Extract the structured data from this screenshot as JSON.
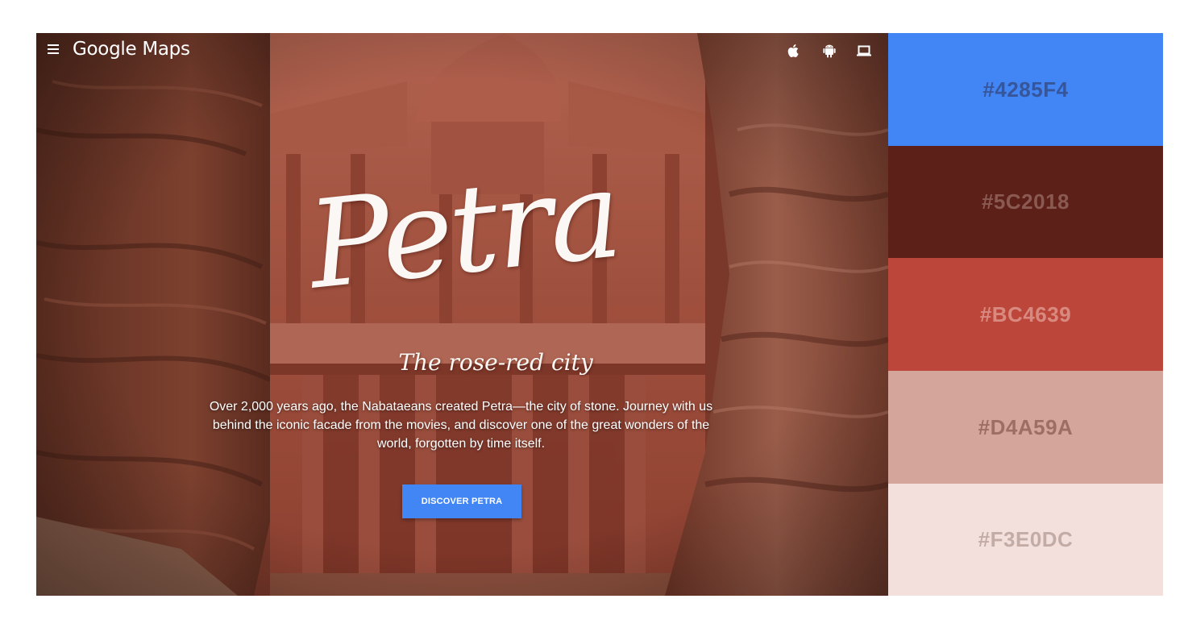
{
  "app": {
    "menu_icon": "hamburger-menu-icon",
    "brand": "Google Maps",
    "platforms": [
      {
        "name": "apple",
        "icon": "apple-icon"
      },
      {
        "name": "android",
        "icon": "android-icon"
      },
      {
        "name": "desktop",
        "icon": "laptop-icon"
      }
    ]
  },
  "hero": {
    "title": "Petra",
    "subtitle": "The rose-red city",
    "description": "Over 2,000 years ago, the Nabataeans created Petra—the city of stone. Journey with us behind the iconic facade from the movies, and discover one of the great wonders of the world, forgotten by time itself.",
    "cta_label": "DISCOVER PETRA"
  },
  "palette": [
    {
      "label": "#4285F4",
      "color": "#4285F4",
      "text_color": "#37569a"
    },
    {
      "label": "#5C2018",
      "color": "#5C2018",
      "text_color": "#8a5a52"
    },
    {
      "label": "#BC4639",
      "color": "#BC4639",
      "text_color": "#d98a80"
    },
    {
      "label": "#D4A59A",
      "color": "#D4A59A",
      "text_color": "#9e6e64"
    },
    {
      "label": "#F3E0DC",
      "color": "#F3E0DC",
      "text_color": "#c4aca6"
    }
  ],
  "colors": {
    "accent": "#4285f4",
    "rock_dark": "#5c2018",
    "rock_mid": "#bc4639",
    "rock_light": "#d4a59a"
  }
}
